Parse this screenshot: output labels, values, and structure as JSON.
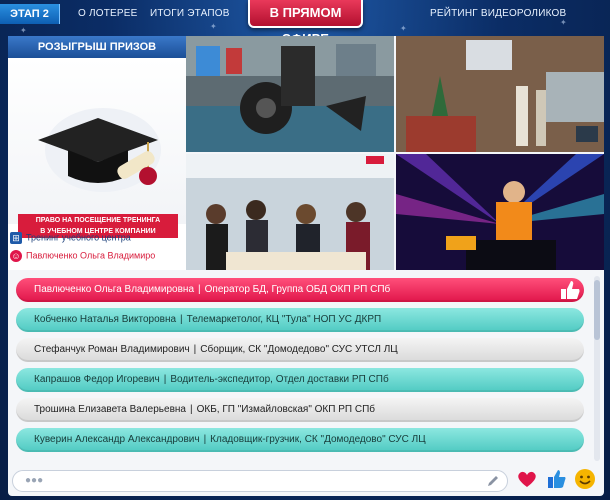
{
  "nav": {
    "stage": "ЭТАП 2",
    "about": "О ЛОТЕРЕЕ",
    "results": "ИТОГИ ЭТАПОВ",
    "live": "В ПРЯМОМ ЭФИРЕ",
    "rating": "РЕЙТИНГ ВИДЕОРОЛИКОВ"
  },
  "prize": {
    "title": "РОЗЫГРЫШ ПРИЗОВ",
    "caption_line1": "ПРАВО НА ПОСЕЩЕНИЕ ТРЕНИНГА",
    "caption_line2": "В УЧЕБНОМ ЦЕНТРЕ КОМПАНИИ",
    "item_label": "Тренинг учебного центра",
    "winner": "Павлюченко Ольга Владимиро"
  },
  "participants": [
    {
      "name": "Павлюченко Ольга Владимировна",
      "info": "Оператор БД, Группа ОБД ОКП РП СПб",
      "style": "pink"
    },
    {
      "name": "Кобченко Наталья Викторовна",
      "info": "Телемаркетолог, КЦ \"Тула\" НОП УС ДКРП",
      "style": "teal"
    },
    {
      "name": "Стефанчук Роман Владимирович",
      "info": "Сборщик, СК \"Домодедово\" СУС УТСЛ ЛЦ",
      "style": "grey"
    },
    {
      "name": "Капрашов Федор Игоревич",
      "info": "Водитель-экспедитор, Отдел доставки РП СПб",
      "style": "teal"
    },
    {
      "name": "Трошина Елизавета Валерьевна",
      "info": "ОКБ, ГП \"Измайловская\" ОКП РП СПб",
      "style": "grey"
    },
    {
      "name": "Куверин Александр Александрович",
      "info": "Кладовщик-грузчик, СК \"Домодедово\" СУС ЛЦ",
      "style": "teal"
    }
  ],
  "separator": "|",
  "comment": {
    "placeholder": "●●●"
  },
  "colors": {
    "pink": "#e0154a",
    "teal": "#4fcac2",
    "navy": "#0b2d66",
    "accent_red": "#d81c3c"
  },
  "icons": [
    "gift-icon",
    "smiley-icon",
    "thumbs-up-icon",
    "pencil-icon",
    "heart-icon",
    "like-icon",
    "smile-icon"
  ]
}
